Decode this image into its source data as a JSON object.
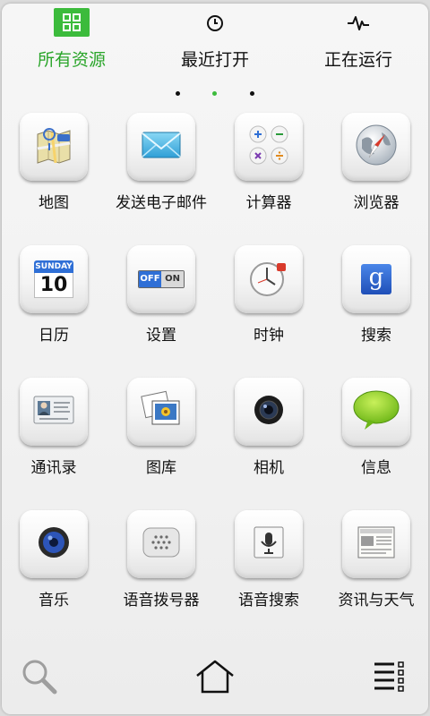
{
  "tabs": [
    {
      "label": "所有资源",
      "icon": "grid-icon",
      "active": true
    },
    {
      "label": "最近打开",
      "icon": "clock-icon",
      "active": false
    },
    {
      "label": "正在运行",
      "icon": "activity-icon",
      "active": false
    }
  ],
  "page_indicator": {
    "count": 3,
    "current": 2
  },
  "apps": [
    {
      "label": "地图",
      "icon": "maps-icon"
    },
    {
      "label": "发送电子邮件",
      "icon": "email-icon"
    },
    {
      "label": "计算器",
      "icon": "calculator-icon"
    },
    {
      "label": "浏览器",
      "icon": "browser-compass-icon"
    },
    {
      "label": "日历",
      "icon": "calendar-icon",
      "calendar_day_name": "SUNDAY",
      "calendar_day_number": "10"
    },
    {
      "label": "设置",
      "icon": "settings-toggle-icon",
      "toggle_off": "OFF",
      "toggle_on": "ON"
    },
    {
      "label": "时钟",
      "icon": "clock-app-icon"
    },
    {
      "label": "搜索",
      "icon": "google-search-icon",
      "glyph": "g"
    },
    {
      "label": "通讯录",
      "icon": "contacts-icon"
    },
    {
      "label": "图库",
      "icon": "gallery-icon"
    },
    {
      "label": "相机",
      "icon": "camera-icon"
    },
    {
      "label": "信息",
      "icon": "messaging-icon"
    },
    {
      "label": "音乐",
      "icon": "music-speaker-icon"
    },
    {
      "label": "语音拨号器",
      "icon": "voice-dialer-icon"
    },
    {
      "label": "语音搜索",
      "icon": "voice-search-microphone-icon"
    },
    {
      "label": "资讯与天气",
      "icon": "news-weather-icon"
    }
  ],
  "dock": [
    {
      "name": "search-button",
      "icon": "magnifier-icon"
    },
    {
      "name": "home-button",
      "icon": "home-icon"
    },
    {
      "name": "menu-button",
      "icon": "list-menu-icon"
    }
  ],
  "colors": {
    "accent": "#3cbb3c",
    "text": "#111111",
    "background": "#f3f3f3"
  }
}
